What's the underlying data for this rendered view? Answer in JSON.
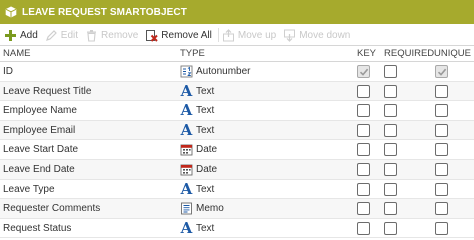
{
  "window": {
    "title": "LEAVE REQUEST SMARTOBJECT",
    "icon": "smartobject-icon"
  },
  "toolbar": {
    "add": {
      "label": "Add",
      "icon": "plus-icon",
      "enabled": true
    },
    "edit": {
      "label": "Edit",
      "icon": "pencil-icon",
      "enabled": false
    },
    "remove": {
      "label": "Remove",
      "icon": "trash-icon",
      "enabled": false
    },
    "remove_all": {
      "label": "Remove All",
      "icon": "remove-all-icon",
      "enabled": true
    },
    "move_up": {
      "label": "Move up",
      "icon": "move-up-icon",
      "enabled": false
    },
    "move_down": {
      "label": "Move down",
      "icon": "move-down-icon",
      "enabled": false
    }
  },
  "columns": {
    "name": "NAME",
    "type": "TYPE",
    "key": "KEY",
    "required": "REQUIRED",
    "unique": "UNIQUE"
  },
  "rows": [
    {
      "name": "ID",
      "type": "Autonumber",
      "type_icon": "autonumber-icon",
      "key": true,
      "required": false,
      "unique": true
    },
    {
      "name": "Leave Request Title",
      "type": "Text",
      "type_icon": "text-icon",
      "key": false,
      "required": false,
      "unique": false
    },
    {
      "name": "Employee Name",
      "type": "Text",
      "type_icon": "text-icon",
      "key": false,
      "required": false,
      "unique": false
    },
    {
      "name": "Employee Email",
      "type": "Text",
      "type_icon": "text-icon",
      "key": false,
      "required": false,
      "unique": false
    },
    {
      "name": "Leave Start Date",
      "type": "Date",
      "type_icon": "date-icon",
      "key": false,
      "required": false,
      "unique": false
    },
    {
      "name": "Leave End Date",
      "type": "Date",
      "type_icon": "date-icon",
      "key": false,
      "required": false,
      "unique": false
    },
    {
      "name": "Leave Type",
      "type": "Text",
      "type_icon": "text-icon",
      "key": false,
      "required": false,
      "unique": false
    },
    {
      "name": "Requester Comments",
      "type": "Memo",
      "type_icon": "memo-icon",
      "key": false,
      "required": false,
      "unique": false
    },
    {
      "name": "Request Status",
      "type": "Text",
      "type_icon": "text-icon",
      "key": false,
      "required": false,
      "unique": false
    }
  ],
  "colors": {
    "titlebar": "#a6aa2d",
    "text_icon": "#1d5aa6",
    "add_icon": "#7a9a1f",
    "remove_all_icon": "#c0281c"
  }
}
